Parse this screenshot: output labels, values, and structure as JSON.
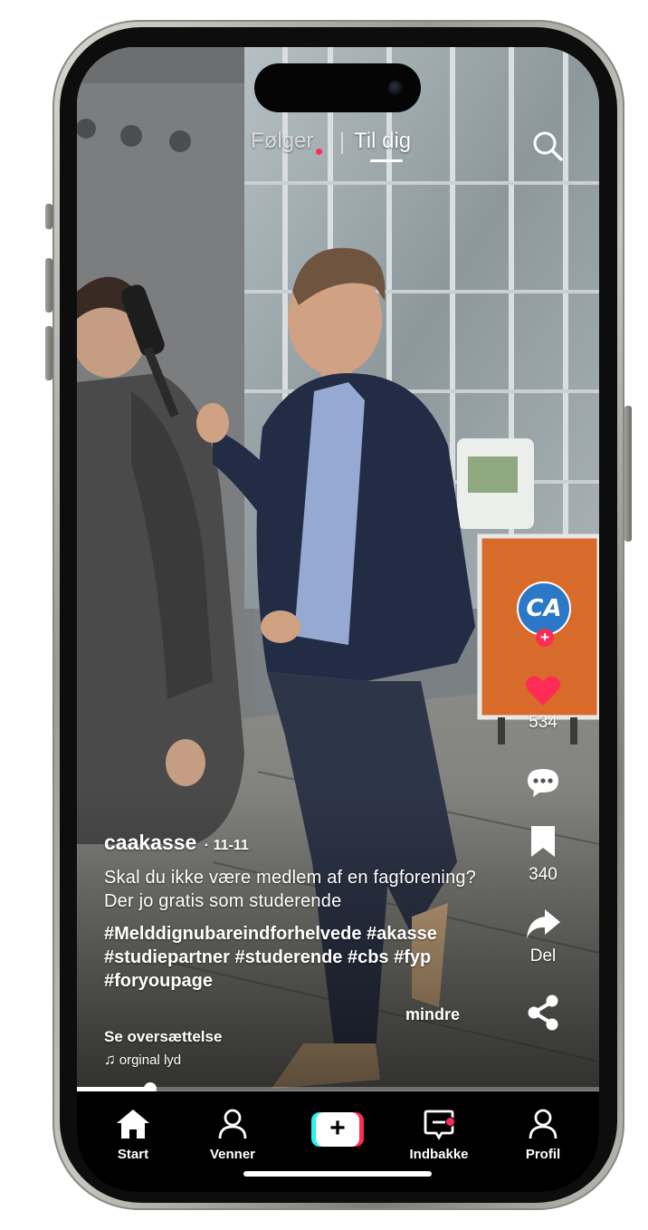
{
  "top_tabs": {
    "following": "Følger",
    "for_you": "Til dig"
  },
  "actions": {
    "avatar_text": "CA",
    "likes": "534",
    "bookmarks": "340",
    "share_label": "Del"
  },
  "post": {
    "username": "caakasse",
    "date": "· 11-11",
    "description": "Skal du ikke være medlem af en fagforening? Der jo gratis som studerende",
    "hashtags": "#Melddignubareindforhelvede #akasse #studiepartner #studerende #cbs #fyp #foryoupage",
    "less_label": "mindre",
    "translate_label": "Se oversættelse",
    "sound": "orginal lyd"
  },
  "progress": {
    "fraction": 0.14
  },
  "nav": {
    "home": "Start",
    "friends": "Venner",
    "inbox": "Indbakke",
    "profile": "Profil"
  },
  "colors": {
    "accent": "#fe2c55",
    "cyan": "#25f4ee",
    "avatar_bg": "#2a78c7",
    "nav_bg": "#000000"
  },
  "icons": {
    "search": "search-icon",
    "heart": "heart-icon",
    "comment": "comment-icon",
    "bookmark": "bookmark-icon",
    "forward": "forward-arrow-icon",
    "share": "share-nodes-icon",
    "home": "home-icon",
    "friends": "person-icon",
    "create": "plus-icon",
    "inbox": "inbox-icon",
    "profile": "profile-icon",
    "music": "music-note-icon"
  }
}
